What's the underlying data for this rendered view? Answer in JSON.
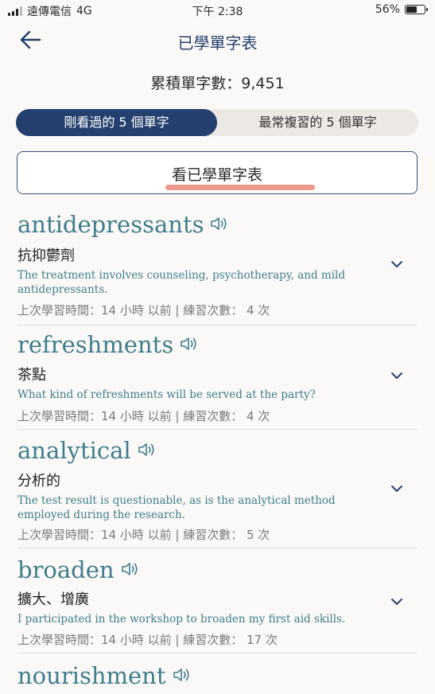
{
  "status_bar": {
    "carrier": "遠傳電信",
    "network": "4G",
    "time": "下午 2:38",
    "battery": "56%",
    "battery_level": 0.56
  },
  "header": {
    "title": "已學單字表",
    "back_icon": "arrow-left-icon"
  },
  "summary": {
    "total_label": "累積單字數：9,451"
  },
  "tabs": [
    {
      "label": "剛看過的 5 個單字",
      "active": true
    },
    {
      "label": "最常複習的 5 個單字",
      "active": false
    }
  ],
  "view_button": {
    "label": "看已學單字表"
  },
  "words": [
    {
      "term": "antidepressants",
      "meaning": "抗抑鬱劑",
      "example": "The treatment involves counseling, psychotherapy, and mild antidepressants.",
      "meta": "上次學習時間：14 小時 以前 | 練習次數： 4 次"
    },
    {
      "term": "refreshments",
      "meaning": "茶點",
      "example": "What kind of refreshments will be served at the party?",
      "meta": "上次學習時間：14 小時 以前 | 練習次數： 4 次"
    },
    {
      "term": "analytical",
      "meaning": "分析的",
      "example": "The test result is questionable, as is the analytical method employed during the research.",
      "meta": "上次學習時間：14 小時 以前 | 練習次數： 5 次"
    },
    {
      "term": "broaden",
      "meaning": "擴大、增廣",
      "example": "I participated in the workshop to broaden my first aid skills.",
      "meta": "上次學習時間：14 小時 以前 | 練習次數： 17 次"
    },
    {
      "term": "nourishment"
    }
  ],
  "colors": {
    "primary": "#25406e",
    "teal": "#3e7d8c",
    "highlight": "#e99a8b",
    "background": "#fbf9f7"
  }
}
